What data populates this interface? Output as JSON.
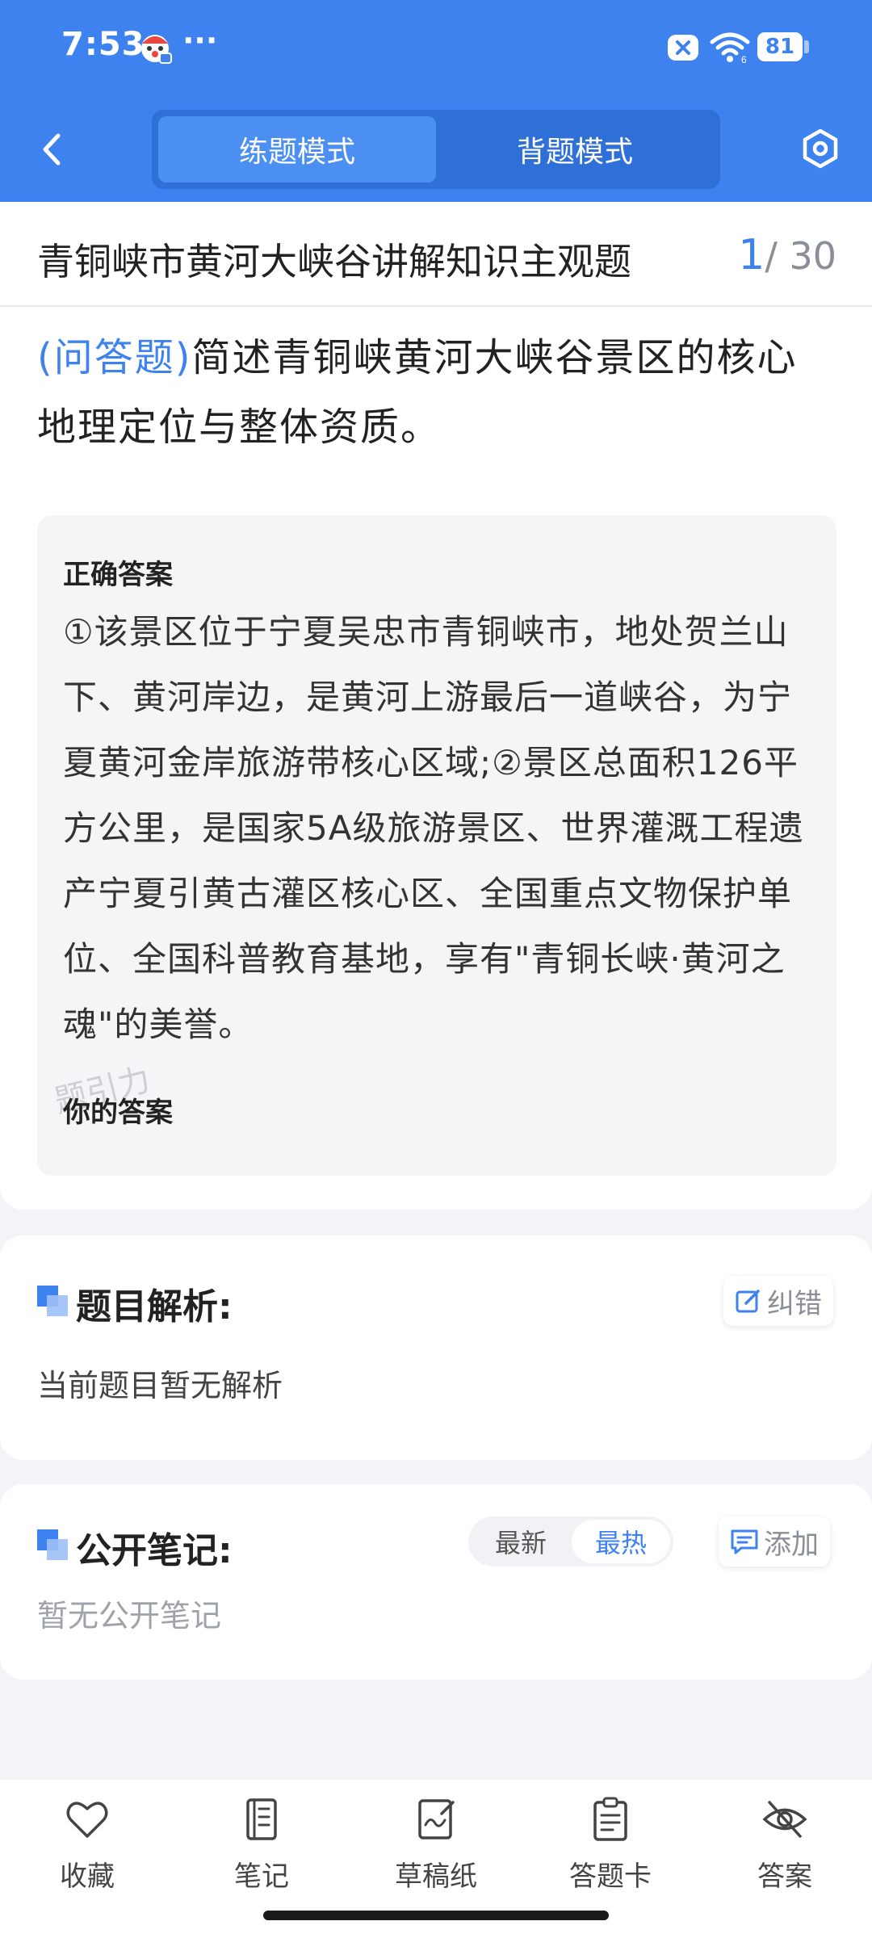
{
  "status_bar": {
    "time": "7:53",
    "more": "···",
    "battery": "81",
    "icons": [
      "app-mascot-icon",
      "sim-off-icon",
      "wifi-icon",
      "battery-icon"
    ]
  },
  "header": {
    "tabs": [
      {
        "label": "练题模式",
        "active": true
      },
      {
        "label": "背题模式",
        "active": false
      }
    ],
    "icons": [
      "back-arrow-icon",
      "settings-hexagon-icon"
    ]
  },
  "question_set": {
    "title": "青铜峡市黄河大峡谷讲解知识主观题",
    "current": "1",
    "total": "/ 30"
  },
  "question": {
    "type_label": "(问答题)",
    "stem": "简述青铜峡黄河大峡谷景区的核心地理定位与整体资质。"
  },
  "answer": {
    "correct_label": "正确答案",
    "correct_text": "①该景区位于宁夏吴忠市青铜峡市，地处贺兰山下、黄河岸边，是黄河上游最后一道峡谷，为宁夏黄河金岸旅游带核心区域;②景区总面积126平方公里，是国家5A级旅游景区、世界灌溉工程遗产宁夏引黄古灌区核心区、全国重点文物保护单位、全国科普教育基地，享有\"青铜长峡·黄河之魂\"的美誉。",
    "watermark": "题引力",
    "your_label": "你的答案"
  },
  "analysis": {
    "title": "题目解析:",
    "correct_btn": "纠错",
    "body": "当前题目暂无解析"
  },
  "notes": {
    "title": "公开笔记:",
    "sort_latest": "最新",
    "sort_hot": "最热",
    "sort_selected": "最热",
    "add_btn": "添加",
    "empty": "暂无公开笔记"
  },
  "bottom_nav": {
    "items": [
      {
        "label": "收藏",
        "icon": "heart-icon"
      },
      {
        "label": "笔记",
        "icon": "notebook-icon"
      },
      {
        "label": "草稿纸",
        "icon": "draft-paper-icon"
      },
      {
        "label": "答题卡",
        "icon": "answer-sheet-icon"
      },
      {
        "label": "答案",
        "icon": "eye-off-icon"
      }
    ]
  },
  "colors": {
    "primary": "#3d82ef",
    "header_dark": "#2f6fd8",
    "background": "#f3f4f8"
  }
}
